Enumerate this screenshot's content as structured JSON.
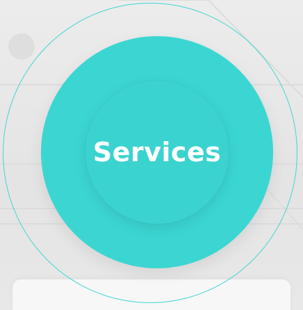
{
  "hero": {
    "label": "Services"
  },
  "colors": {
    "accent": "#3bd6d2",
    "ring": "#3fd6d3",
    "label": "#ffffff",
    "background": "#e9e9e9",
    "card": "#f7f7f7"
  }
}
